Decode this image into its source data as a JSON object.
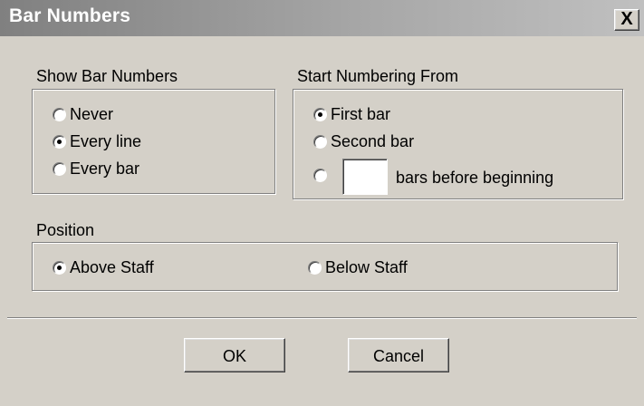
{
  "window": {
    "title": "Bar Numbers",
    "close_label": "X"
  },
  "show_bar_numbers": {
    "label": "Show Bar Numbers",
    "options": [
      {
        "label": "Never",
        "checked": false
      },
      {
        "label": "Every line",
        "checked": true
      },
      {
        "label": "Every bar",
        "checked": false
      }
    ]
  },
  "start_numbering": {
    "label": "Start Numbering From",
    "options": [
      {
        "label": "First bar",
        "checked": true
      },
      {
        "label": "Second bar",
        "checked": false
      },
      {
        "label": "bars before beginning",
        "checked": false,
        "input_value": ""
      }
    ]
  },
  "position": {
    "label": "Position",
    "options": [
      {
        "label": "Above Staff",
        "checked": true
      },
      {
        "label": "Below Staff",
        "checked": false
      }
    ]
  },
  "buttons": {
    "ok": "OK",
    "cancel": "Cancel"
  }
}
